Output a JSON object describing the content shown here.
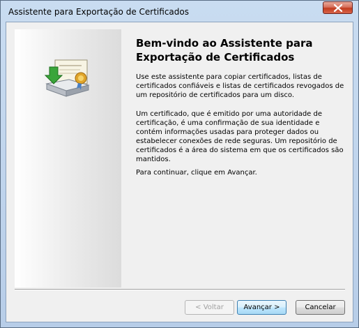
{
  "window": {
    "title": "Assistente para Exportação de Certificados"
  },
  "icons": {
    "close": "close-icon",
    "wizard": "certificate-export-icon"
  },
  "content": {
    "title": "Bem-vindo ao Assistente para Exportação de Certificados",
    "paragraph1": "Use este assistente para copiar certificados, listas de certificados confiáveis e listas de certificados revogados de um repositório de certificados para um disco.",
    "paragraph2": "Um certificado, que é emitido por uma autoridade de certificação, é uma confirmação de sua identidade e contém informações usadas para proteger dados ou estabelecer conexões de rede seguras. Um repositório de certificados é a área do sistema em que os certificados são mantidos.",
    "paragraph3": "Para continuar, clique em Avançar."
  },
  "buttons": {
    "back": "< Voltar",
    "next": "Avançar >",
    "cancel": "Cancelar"
  },
  "colors": {
    "close_button": "#c9452b",
    "default_button_border": "#3c7fb1"
  }
}
